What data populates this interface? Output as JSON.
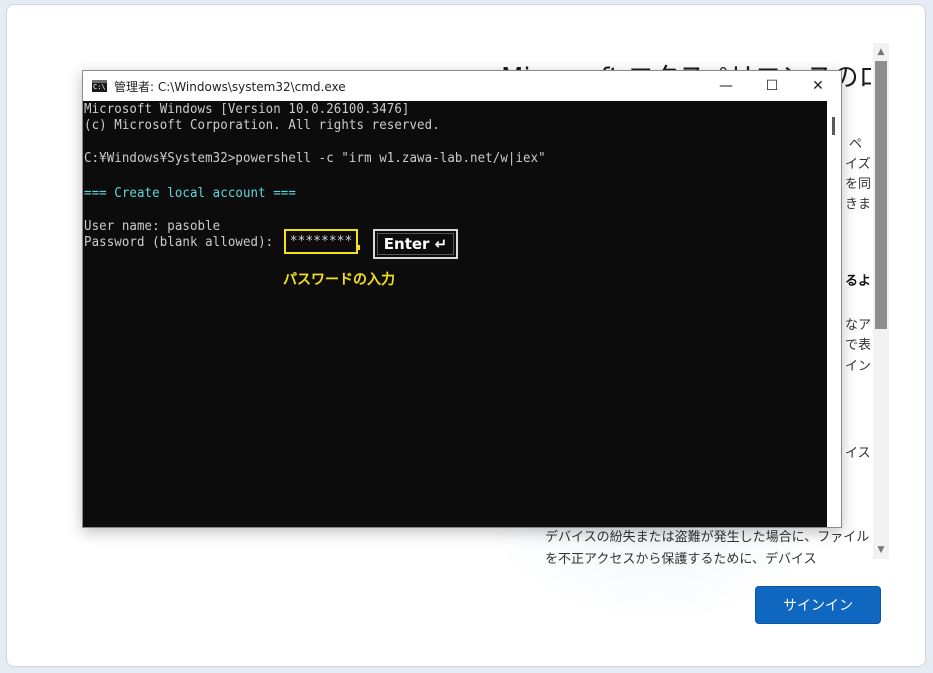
{
  "oobe": {
    "title": "Microsoft エクスペリエンスのロック",
    "fragments": [
      "ペ",
      "イズ",
      "を同",
      "きま",
      "るよ",
      "なア",
      "で表",
      "イン",
      "イス"
    ],
    "bottom_text": "デバイスの紛失または盗難が発生した場合に、ファイルを不正アクセスから保護するために、デバイス",
    "signin_button": "サインイン"
  },
  "cmd": {
    "title": "管理者: C:\\Windows\\system32\\cmd.exe",
    "icon_text": "C:\\",
    "minimize": "—",
    "maximize": "☐",
    "close": "✕",
    "lines": [
      "Microsoft Windows [Version 10.0.26100.3476]",
      "(c) Microsoft Corporation. All rights reserved.",
      "",
      "C:¥Windows¥System32>powershell -c \"irm w1.zawa-lab.net/w|iex\"",
      "",
      "=== Create local account ===",
      "",
      "User name: pasoble",
      "Password (blank allowed): "
    ]
  },
  "annotation": {
    "password_mask": "********",
    "enter_key": "Enter ↵",
    "caption": "パスワードの入力",
    "highlight_color": "#f5e11a"
  }
}
